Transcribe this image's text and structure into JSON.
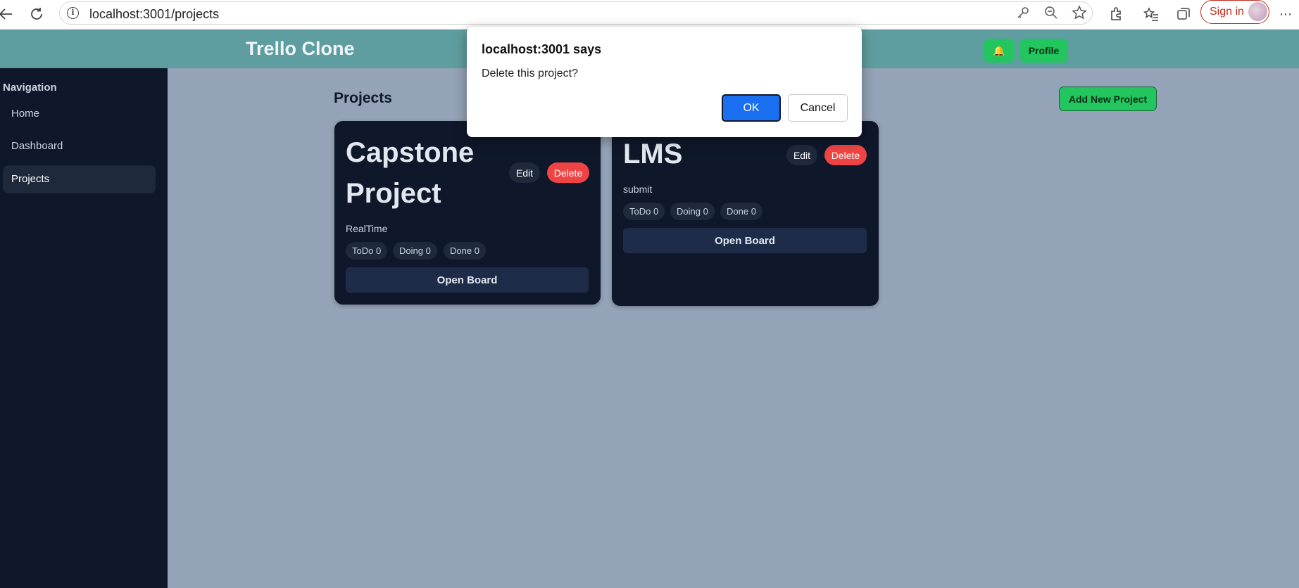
{
  "browser": {
    "url": "localhost:3001/projects",
    "signin_label": "Sign in"
  },
  "header": {
    "title": "Trello Clone",
    "bell_icon": "🔔",
    "profile_label": "Profile"
  },
  "sidebar": {
    "heading": "Navigation",
    "items": [
      {
        "label": "Home",
        "active": false
      },
      {
        "label": "Dashboard",
        "active": false
      },
      {
        "label": "Projects",
        "active": true
      }
    ]
  },
  "main": {
    "title": "Projects",
    "add_button_label": "Add New Project",
    "projects": [
      {
        "title_line1": "Capstone",
        "title_line2": "Project",
        "edit_label": "Edit",
        "delete_label": "Delete",
        "description": "RealTime",
        "chips": [
          "ToDo 0",
          "Doing 0",
          "Done 0"
        ],
        "open_label": "Open Board"
      },
      {
        "title_line1": "LMS",
        "edit_label": "Edit",
        "delete_label": "Delete",
        "description": "submit",
        "chips": [
          "ToDo 0",
          "Doing 0",
          "Done 0"
        ],
        "open_label": "Open Board"
      }
    ]
  },
  "dialog": {
    "title": "localhost:3001 says",
    "message": "Delete this project?",
    "ok_label": "OK",
    "cancel_label": "Cancel"
  },
  "colors": {
    "header": "#5f9ea0",
    "sidebar": "#0f172a",
    "page_background": "#94a3b8",
    "accent_green": "#22c55e",
    "delete_red": "#ef4444",
    "dialog_ok": "#1a6ff0"
  }
}
